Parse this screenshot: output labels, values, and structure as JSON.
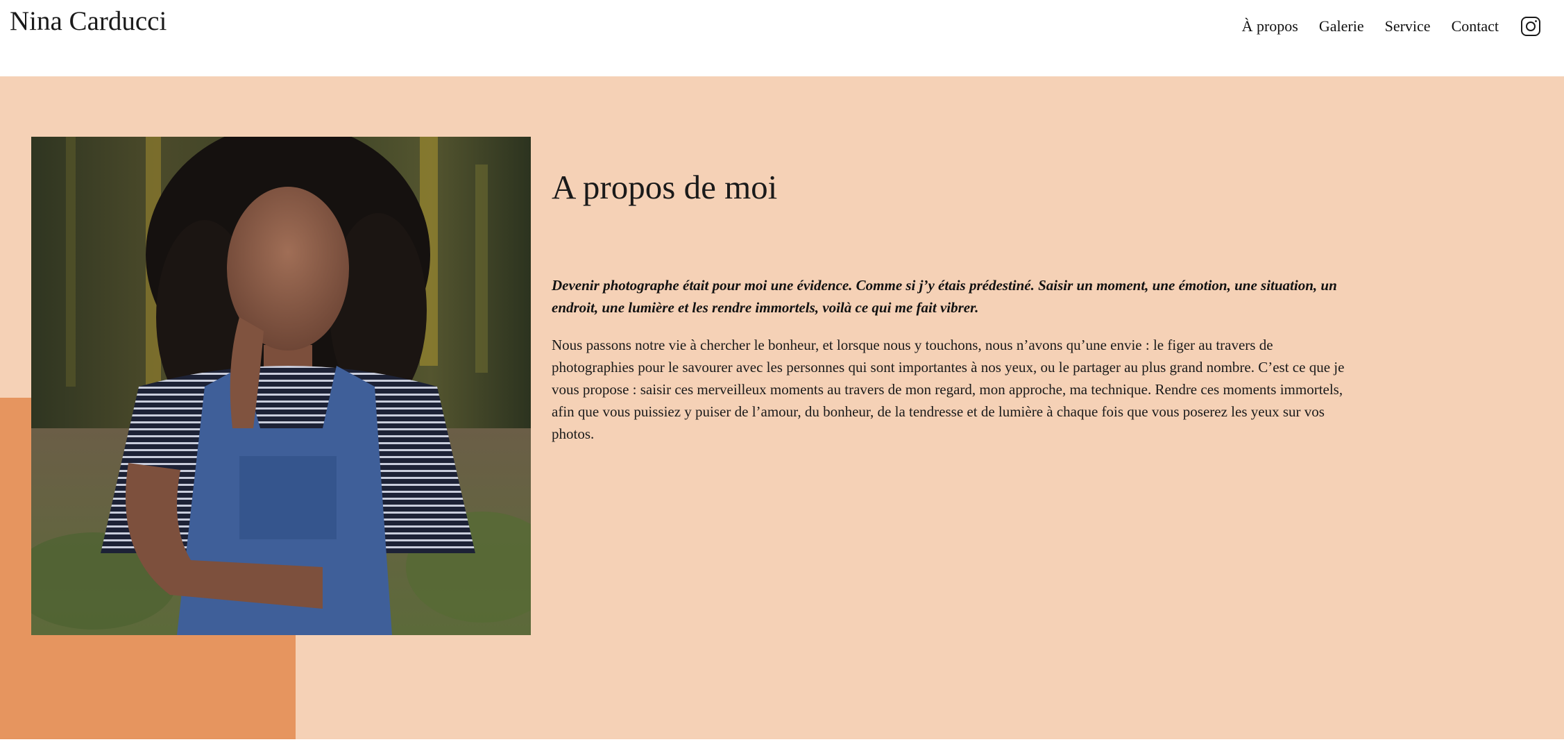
{
  "header": {
    "site_title": "Nina Carducci",
    "nav": [
      "À propos",
      "Galerie",
      "Service",
      "Contact"
    ],
    "instagram_icon": "instagram-icon"
  },
  "about": {
    "title": "A propos de moi",
    "intro": "Devenir photographe était pour moi une évidence. Comme si j’y étais prédestiné. Saisir un moment, une émotion, une situation, un endroit, une lumière et les rendre immortels, voilà ce qui me fait vibrer.",
    "body": "Nous passons notre vie à chercher le bonheur, et lorsque nous y touchons, nous n’avons qu’une envie : le figer au travers de photographies pour le savourer avec les personnes qui sont importantes à nos yeux, ou le partager au plus grand nombre. C’est ce que je vous propose : saisir ces merveilleux moments au travers de mon regard, mon approche, ma technique. Rendre ces moments immortels, afin que vous puissiez y puiser de l’amour, du bonheur, de la tendresse et de lumière à chaque fois que vous poserez les yeux sur vos photos."
  },
  "colors": {
    "section_background": "#f5d1b6",
    "accent": "#e6955f",
    "text": "#1a1a1a"
  }
}
